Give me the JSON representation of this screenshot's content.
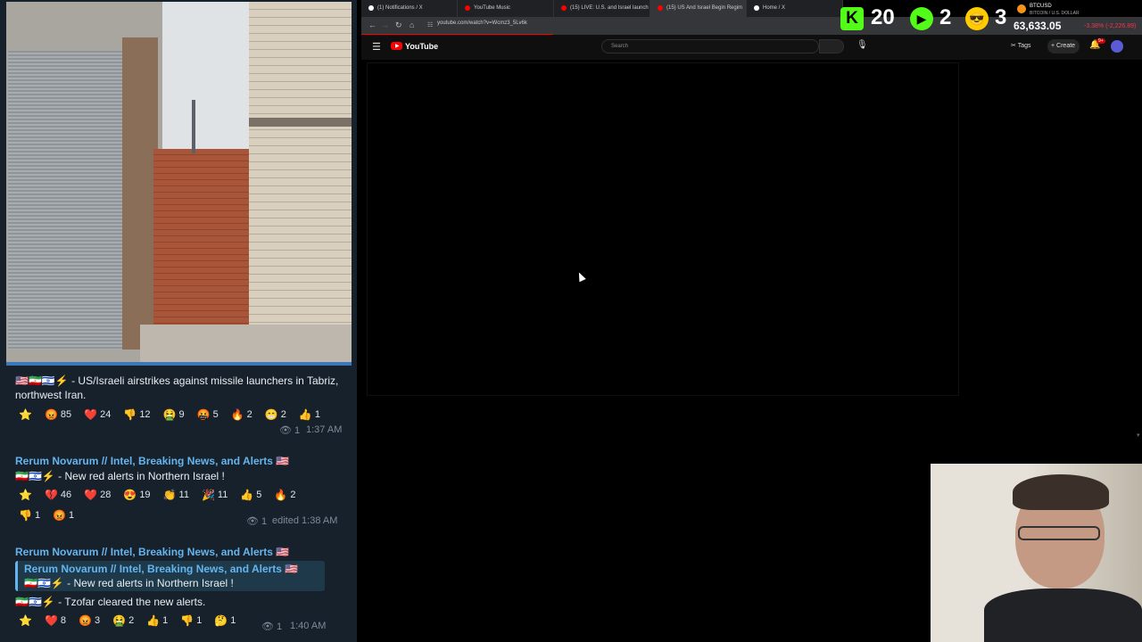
{
  "telegram": {
    "post1": {
      "text": "🇺🇸🇮🇷🇮🇱⚡ - US/Israeli airstrikes against missile launchers in Tabriz, northwest Iran.",
      "reactions": [
        [
          "⭐",
          ""
        ],
        [
          "😡",
          "85"
        ],
        [
          "❤️",
          "24"
        ],
        [
          "👎",
          "12"
        ],
        [
          "🤮",
          "9"
        ],
        [
          "🤬",
          "5"
        ],
        [
          "🔥",
          "2"
        ],
        [
          "😁",
          "2"
        ],
        [
          "👍",
          "1"
        ]
      ],
      "views": "1",
      "time": "1:37 AM"
    },
    "post2": {
      "sender": "Rerum Novarum // Intel, Breaking News, and Alerts 🇺🇸",
      "text": "🇮🇷🇮🇱⚡ - New red alerts in Northern Israel !",
      "reactions": [
        [
          "⭐",
          ""
        ],
        [
          "💔",
          "46"
        ],
        [
          "❤️",
          "28"
        ],
        [
          "😍",
          "19"
        ],
        [
          "👏",
          "11"
        ],
        [
          "🎉",
          "11"
        ],
        [
          "👍",
          "5"
        ],
        [
          "🔥",
          "2"
        ]
      ],
      "reactions_row2": [
        [
          "👎",
          "1"
        ],
        [
          "😡",
          "1"
        ]
      ],
      "views": "1",
      "time": "edited 1:38 AM"
    },
    "post3": {
      "sender": "Rerum Novarum // Intel, Breaking News, and Alerts 🇺🇸",
      "quote_sender": "Rerum Novarum // Intel, Breaking News, and Alerts 🇺🇸",
      "quote_text": "🇮🇷🇮🇱⚡ - New red alerts in Northern Israel !",
      "text": "🇮🇷🇮🇱⚡ - Tzofar cleared the new alerts.",
      "reactions": [
        [
          "⭐",
          ""
        ],
        [
          "❤️",
          "8"
        ],
        [
          "😡",
          "3"
        ],
        [
          "🤮",
          "2"
        ],
        [
          "👍",
          "1"
        ],
        [
          "👎",
          "1"
        ],
        [
          "🤔",
          "1"
        ]
      ],
      "views": "1",
      "time": "1:40 AM"
    }
  },
  "browser": {
    "tabs": [
      {
        "label": "(1) Notifications / X",
        "color": "#ffffff"
      },
      {
        "label": "YouTube Music",
        "color": "#ff0000"
      },
      {
        "label": "(15) LIVE: U.S. and Israel launch",
        "color": "#ff0000"
      },
      {
        "label": "(15) US And Israel Begin Regim",
        "color": "#ff0000"
      },
      {
        "label": "Home / X",
        "color": "#ffffff"
      }
    ],
    "url": "youtube.com/watch?v=Wcmz3_5Lv6k",
    "youtube": {
      "logo_text": "YouTube",
      "search_placeholder": "Search",
      "tags_label": "Tags",
      "create_label": "Create",
      "notif_count": "9+"
    }
  },
  "widgets": {
    "kick_count": "20",
    "yt_count": "2",
    "emoji_count": "3",
    "btc_label": "BTCUSD",
    "btc_sub": "BITCOIN / U.S. DOLLAR",
    "btc_price": "63,633.05",
    "btc_change": "-3.38% (-2,226.89)"
  },
  "colors": {
    "telegram_bg": "#17212b",
    "link": "#64b5ef",
    "youtube_red": "#ff0000"
  }
}
